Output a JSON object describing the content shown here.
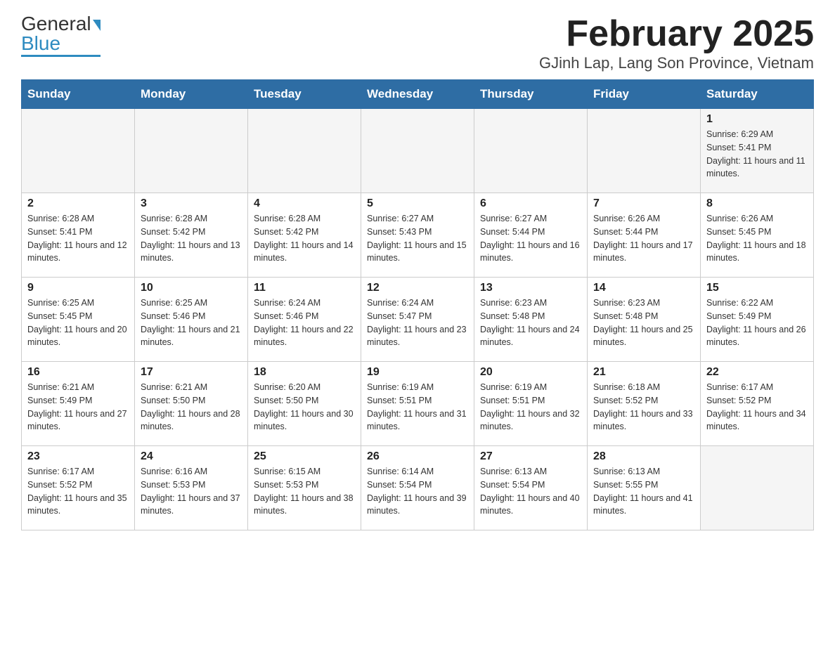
{
  "header": {
    "logo_general": "General",
    "logo_blue": "Blue",
    "title": "February 2025",
    "subtitle": "GJinh Lap, Lang Son Province, Vietnam"
  },
  "days_of_week": [
    "Sunday",
    "Monday",
    "Tuesday",
    "Wednesday",
    "Thursday",
    "Friday",
    "Saturday"
  ],
  "weeks": [
    [
      {
        "day": "",
        "info": ""
      },
      {
        "day": "",
        "info": ""
      },
      {
        "day": "",
        "info": ""
      },
      {
        "day": "",
        "info": ""
      },
      {
        "day": "",
        "info": ""
      },
      {
        "day": "",
        "info": ""
      },
      {
        "day": "1",
        "info": "Sunrise: 6:29 AM\nSunset: 5:41 PM\nDaylight: 11 hours and 11 minutes."
      }
    ],
    [
      {
        "day": "2",
        "info": "Sunrise: 6:28 AM\nSunset: 5:41 PM\nDaylight: 11 hours and 12 minutes."
      },
      {
        "day": "3",
        "info": "Sunrise: 6:28 AM\nSunset: 5:42 PM\nDaylight: 11 hours and 13 minutes."
      },
      {
        "day": "4",
        "info": "Sunrise: 6:28 AM\nSunset: 5:42 PM\nDaylight: 11 hours and 14 minutes."
      },
      {
        "day": "5",
        "info": "Sunrise: 6:27 AM\nSunset: 5:43 PM\nDaylight: 11 hours and 15 minutes."
      },
      {
        "day": "6",
        "info": "Sunrise: 6:27 AM\nSunset: 5:44 PM\nDaylight: 11 hours and 16 minutes."
      },
      {
        "day": "7",
        "info": "Sunrise: 6:26 AM\nSunset: 5:44 PM\nDaylight: 11 hours and 17 minutes."
      },
      {
        "day": "8",
        "info": "Sunrise: 6:26 AM\nSunset: 5:45 PM\nDaylight: 11 hours and 18 minutes."
      }
    ],
    [
      {
        "day": "9",
        "info": "Sunrise: 6:25 AM\nSunset: 5:45 PM\nDaylight: 11 hours and 20 minutes."
      },
      {
        "day": "10",
        "info": "Sunrise: 6:25 AM\nSunset: 5:46 PM\nDaylight: 11 hours and 21 minutes."
      },
      {
        "day": "11",
        "info": "Sunrise: 6:24 AM\nSunset: 5:46 PM\nDaylight: 11 hours and 22 minutes."
      },
      {
        "day": "12",
        "info": "Sunrise: 6:24 AM\nSunset: 5:47 PM\nDaylight: 11 hours and 23 minutes."
      },
      {
        "day": "13",
        "info": "Sunrise: 6:23 AM\nSunset: 5:48 PM\nDaylight: 11 hours and 24 minutes."
      },
      {
        "day": "14",
        "info": "Sunrise: 6:23 AM\nSunset: 5:48 PM\nDaylight: 11 hours and 25 minutes."
      },
      {
        "day": "15",
        "info": "Sunrise: 6:22 AM\nSunset: 5:49 PM\nDaylight: 11 hours and 26 minutes."
      }
    ],
    [
      {
        "day": "16",
        "info": "Sunrise: 6:21 AM\nSunset: 5:49 PM\nDaylight: 11 hours and 27 minutes."
      },
      {
        "day": "17",
        "info": "Sunrise: 6:21 AM\nSunset: 5:50 PM\nDaylight: 11 hours and 28 minutes."
      },
      {
        "day": "18",
        "info": "Sunrise: 6:20 AM\nSunset: 5:50 PM\nDaylight: 11 hours and 30 minutes."
      },
      {
        "day": "19",
        "info": "Sunrise: 6:19 AM\nSunset: 5:51 PM\nDaylight: 11 hours and 31 minutes."
      },
      {
        "day": "20",
        "info": "Sunrise: 6:19 AM\nSunset: 5:51 PM\nDaylight: 11 hours and 32 minutes."
      },
      {
        "day": "21",
        "info": "Sunrise: 6:18 AM\nSunset: 5:52 PM\nDaylight: 11 hours and 33 minutes."
      },
      {
        "day": "22",
        "info": "Sunrise: 6:17 AM\nSunset: 5:52 PM\nDaylight: 11 hours and 34 minutes."
      }
    ],
    [
      {
        "day": "23",
        "info": "Sunrise: 6:17 AM\nSunset: 5:52 PM\nDaylight: 11 hours and 35 minutes."
      },
      {
        "day": "24",
        "info": "Sunrise: 6:16 AM\nSunset: 5:53 PM\nDaylight: 11 hours and 37 minutes."
      },
      {
        "day": "25",
        "info": "Sunrise: 6:15 AM\nSunset: 5:53 PM\nDaylight: 11 hours and 38 minutes."
      },
      {
        "day": "26",
        "info": "Sunrise: 6:14 AM\nSunset: 5:54 PM\nDaylight: 11 hours and 39 minutes."
      },
      {
        "day": "27",
        "info": "Sunrise: 6:13 AM\nSunset: 5:54 PM\nDaylight: 11 hours and 40 minutes."
      },
      {
        "day": "28",
        "info": "Sunrise: 6:13 AM\nSunset: 5:55 PM\nDaylight: 11 hours and 41 minutes."
      },
      {
        "day": "",
        "info": ""
      }
    ]
  ]
}
